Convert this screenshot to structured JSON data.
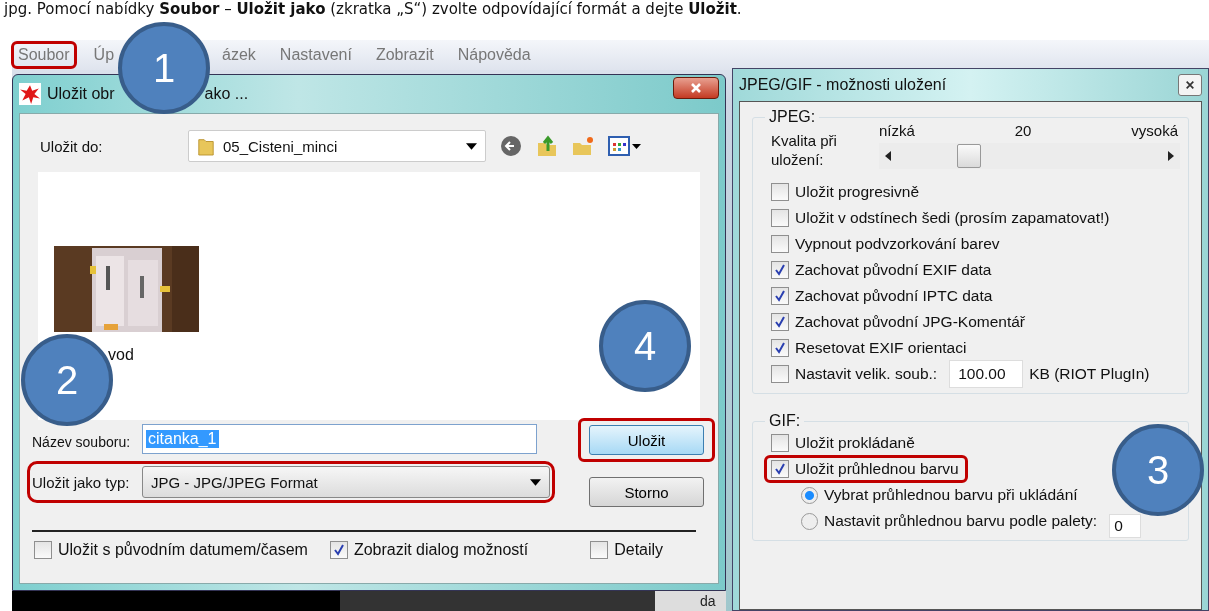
{
  "instruction": "jpg. Pomocí nabídky **Soubor** – **Uložit jako** (zkratka „S“) zvolte odpovídající formát a dejte **Uložit**.",
  "menu": [
    {
      "label": "Soubor",
      "highlighted": true
    },
    {
      "label": "Úp",
      "highlighted": false
    },
    {
      "label": "ázek",
      "highlighted": false
    },
    {
      "label": "Nastavení",
      "highlighted": false
    },
    {
      "label": "Zobrazit",
      "highlighted": false
    },
    {
      "label": "Nápověda",
      "highlighted": false
    }
  ],
  "save_dialog": {
    "title_parts": [
      "Uložit obr",
      "ako ..."
    ],
    "save_in_label": "Uložit do:",
    "folder": "05_Cisteni_minci",
    "files": [
      {
        "name": "vod",
        "kind": "picture"
      }
    ],
    "filename_label": "Název souboru:",
    "filename": "citanka_1",
    "filetype_label": "Uložit jako typ:",
    "filetype": "JPG - JPG/JPEG Format",
    "filetype_highlighted": true,
    "buttons": [
      {
        "label": "Uložit",
        "highlighted": true
      },
      {
        "label": "Storno",
        "highlighted": false
      }
    ],
    "options": [
      {
        "label": "Uložit s původním datumem/časem",
        "checked": false
      },
      {
        "label": "Zobrazit dialog možností",
        "checked": true
      },
      {
        "label": "Detaily",
        "checked": false
      }
    ]
  },
  "background_text": "da",
  "options_dialog": {
    "title": "JPEG/GIF - možnosti uložení",
    "jpeg": {
      "legend": "JPEG:",
      "slider": {
        "label": "Kvalita při uložení:",
        "min_label": "nízká",
        "value": "20",
        "max_label": "vysoká",
        "level": 0.3
      },
      "options": [
        {
          "kind": "checkbox",
          "label": "Uložit progresivně",
          "checked": false
        },
        {
          "kind": "checkbox",
          "label": "Uložit v odstínech šedi (prosím zapamatovat!)",
          "checked": false
        },
        {
          "kind": "checkbox",
          "label": "Vypnout podvzorkování barev",
          "checked": false
        },
        {
          "kind": "checkbox",
          "label": "Zachovat původní EXIF data",
          "checked": true
        },
        {
          "kind": "checkbox",
          "label": "Zachovat původní IPTC data",
          "checked": true
        },
        {
          "kind": "checkbox",
          "label": "Zachovat původní JPG-Komentář",
          "checked": true
        },
        {
          "kind": "checkbox",
          "label": "Resetovat EXIF orientaci",
          "checked": true
        },
        {
          "kind": "size",
          "label": "Nastavit velik. soub.:",
          "checked": false,
          "value": "100.00",
          "unit": "KB (RIOT PlugIn)"
        }
      ]
    },
    "gif": {
      "legend": "GIF:",
      "options": [
        {
          "kind": "checkbox",
          "label": "Uložit prokládaně",
          "checked": false,
          "highlighted": false
        },
        {
          "kind": "checkbox",
          "label": "Uložit průhlednou barvu",
          "checked": true,
          "highlighted": true
        },
        {
          "kind": "radio",
          "label": "Vybrat průhlednou barvu při ukládání",
          "selected": true
        },
        {
          "kind": "radio",
          "label": "Nastavit průhlednou barvu podle palety:",
          "selected": false,
          "value": "0"
        }
      ]
    }
  },
  "annotations": [
    {
      "number": "1"
    },
    {
      "number": "2"
    },
    {
      "number": "3"
    },
    {
      "number": "4"
    }
  ]
}
